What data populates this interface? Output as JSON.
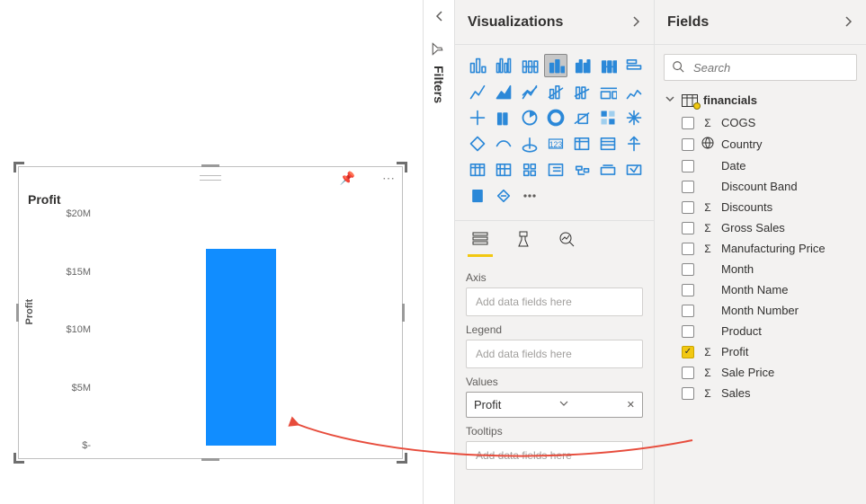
{
  "panes": {
    "filters_label": "Filters",
    "visualizations_title": "Visualizations",
    "fields_title": "Fields"
  },
  "search": {
    "placeholder": "Search"
  },
  "wells": {
    "axis_label": "Axis",
    "axis_placeholder": "Add data fields here",
    "legend_label": "Legend",
    "legend_placeholder": "Add data fields here",
    "values_label": "Values",
    "values_chip": "Profit",
    "tooltips_label": "Tooltips",
    "tooltips_placeholder": "Add data fields here"
  },
  "fields_table": {
    "name": "financials",
    "items": [
      {
        "name": "COGS",
        "sigma": true,
        "checked": false
      },
      {
        "name": "Country",
        "sigma": false,
        "globe": true,
        "checked": false
      },
      {
        "name": "Date",
        "sigma": false,
        "checked": false
      },
      {
        "name": "Discount Band",
        "sigma": false,
        "checked": false
      },
      {
        "name": "Discounts",
        "sigma": true,
        "checked": false
      },
      {
        "name": "Gross Sales",
        "sigma": true,
        "checked": false
      },
      {
        "name": "Manufacturing Price",
        "sigma": true,
        "checked": false
      },
      {
        "name": "Month",
        "sigma": false,
        "checked": false
      },
      {
        "name": "Month Name",
        "sigma": false,
        "checked": false
      },
      {
        "name": "Month Number",
        "sigma": false,
        "checked": false
      },
      {
        "name": "Product",
        "sigma": false,
        "checked": false
      },
      {
        "name": "Profit",
        "sigma": true,
        "checked": true
      },
      {
        "name": "Sale Price",
        "sigma": true,
        "checked": false
      },
      {
        "name": "Sales",
        "sigma": true,
        "checked": false
      }
    ]
  },
  "chart_data": {
    "type": "bar",
    "title": "Profit",
    "ylabel": "Profit",
    "xlabel": "",
    "categories": [
      ""
    ],
    "values": [
      17000000
    ],
    "ylim": [
      0,
      20000000
    ],
    "yticks": [
      {
        "v": 0,
        "label": "$-"
      },
      {
        "v": 5000000,
        "label": "$5M"
      },
      {
        "v": 10000000,
        "label": "$10M"
      },
      {
        "v": 15000000,
        "label": "$15M"
      },
      {
        "v": 20000000,
        "label": "$20M"
      }
    ],
    "bar_color": "#118dff"
  }
}
